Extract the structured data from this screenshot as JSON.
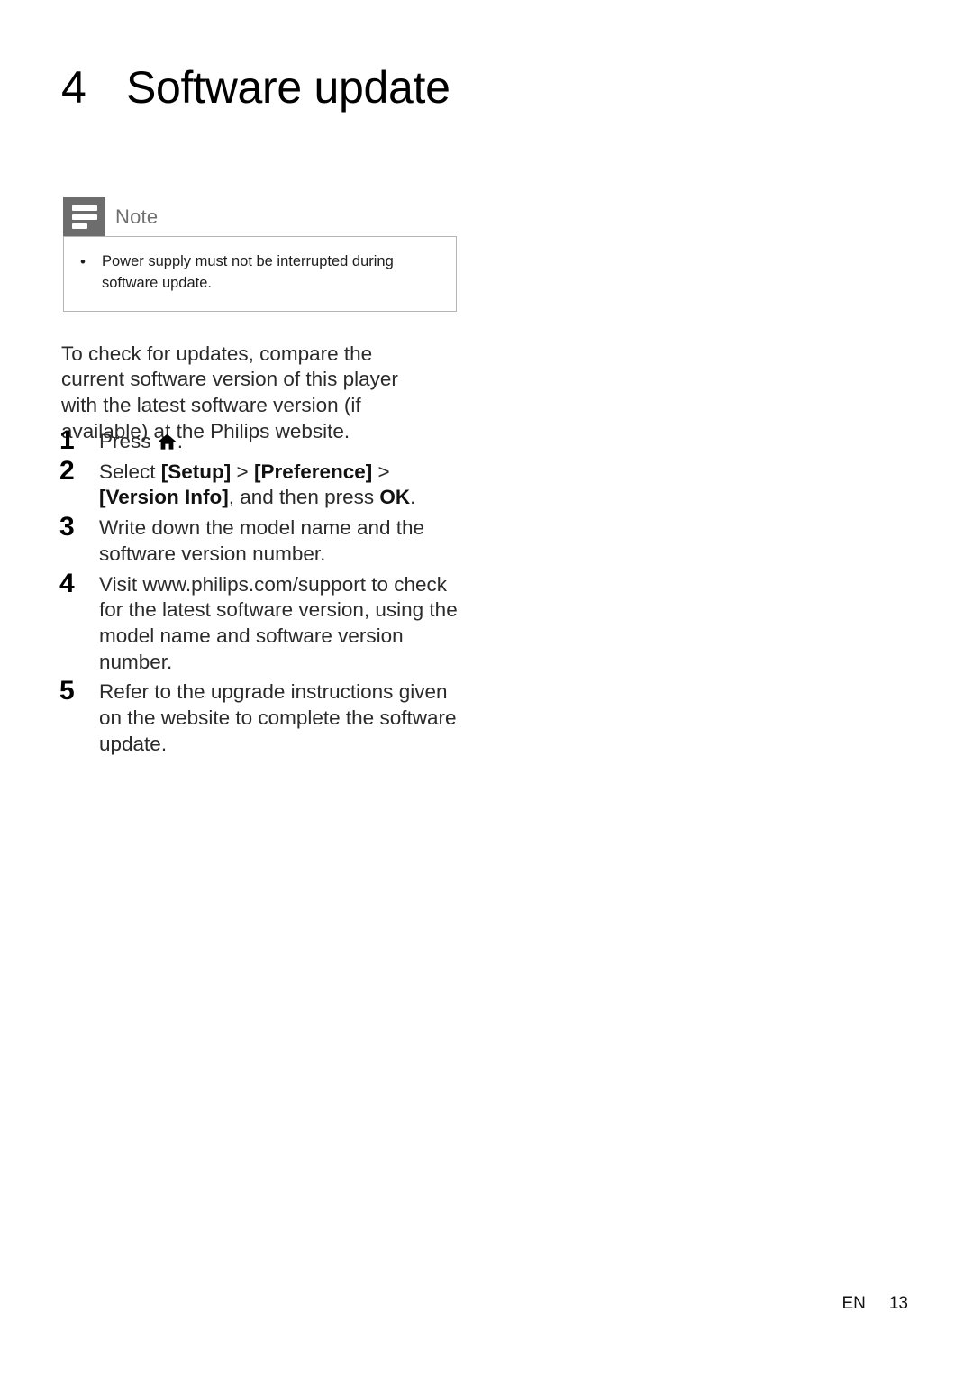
{
  "document": {
    "chapter": {
      "number": "4",
      "title": "Software update"
    },
    "note": {
      "icon": "note-lines-icon",
      "label": "Note",
      "bullet_glyph": "•",
      "items": [
        "Power supply must not be interrupted during software update."
      ]
    },
    "intro": "To check for updates, compare the current software version of this player with the latest software version (if available) at the Philips website.",
    "steps": [
      {
        "number": "1",
        "text_before": "Press ",
        "icon": "home-icon",
        "text_after": "."
      },
      {
        "number": "2",
        "segments": [
          {
            "text": "Select ",
            "bold": false
          },
          {
            "text": "[Setup]",
            "bold": true
          },
          {
            "text": " > ",
            "bold": false
          },
          {
            "text": "[Preference]",
            "bold": true
          },
          {
            "text": " > ",
            "bold": false
          },
          {
            "text": "[Version Info]",
            "bold": true
          },
          {
            "text": ", and then press ",
            "bold": false
          },
          {
            "text": "OK",
            "bold": true
          },
          {
            "text": ".",
            "bold": false
          }
        ]
      },
      {
        "number": "3",
        "text": "Write down the model name and the software version number."
      },
      {
        "number": "4",
        "text": "Visit www.philips.com/support to check for the latest software version, using the model name and software version number."
      },
      {
        "number": "5",
        "text": "Refer to the upgrade instructions given on the website to complete the software update."
      }
    ],
    "footer": {
      "language": "EN",
      "page_number": "13"
    },
    "colors": {
      "note_icon_bg": "#6d6d6d",
      "note_label": "#6f6f6f",
      "note_border": "#b5b5b5",
      "body_text": "#2b2b2b",
      "heading_text": "#000000"
    }
  }
}
